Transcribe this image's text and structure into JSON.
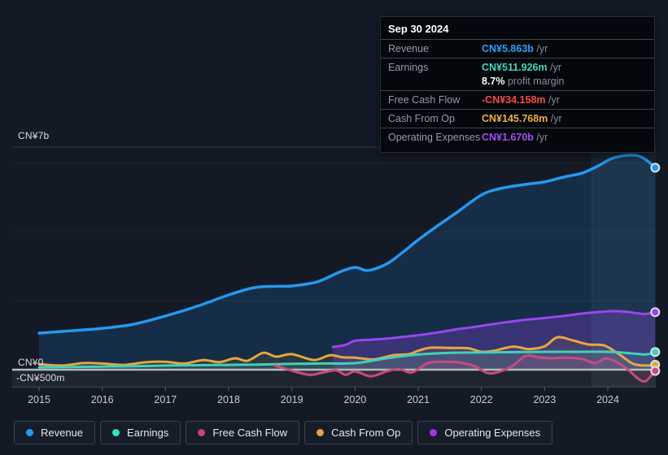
{
  "tooltip": {
    "date": "Sep 30 2024",
    "rows": [
      {
        "label": "Revenue",
        "value": "CN¥5.863b",
        "suffix": " /yr",
        "color": "#2d9ff6"
      },
      {
        "label": "Earnings",
        "value": "CN¥511.926m",
        "suffix": " /yr",
        "color": "#41d6bd",
        "sub_value": "8.7%",
        "sub_text": " profit margin"
      },
      {
        "label": "Free Cash Flow",
        "value": "-CN¥34.158m",
        "suffix": " /yr",
        "color": "#fb4b43"
      },
      {
        "label": "Cash From Op",
        "value": "CN¥145.768m",
        "suffix": " /yr",
        "color": "#ecaf3e"
      },
      {
        "label": "Operating Expenses",
        "value": "CN¥1.670b",
        "suffix": " /yr",
        "color": "#a34ff6"
      }
    ]
  },
  "legend": {
    "items": [
      {
        "label": "Revenue",
        "color": "#1e9df2"
      },
      {
        "label": "Earnings",
        "color": "#30e3c3"
      },
      {
        "label": "Free Cash Flow",
        "color": "#c6417d"
      },
      {
        "label": "Cash From Op",
        "color": "#e5a43c"
      },
      {
        "label": "Operating Expenses",
        "color": "#9e35ea"
      }
    ]
  },
  "chart_data": {
    "type": "line",
    "title": "Company financial history (revenue, earnings and cash flows), CN¥, 2015 - Sep 30 2024",
    "currency_unit": "CN¥ billions",
    "x_axis": {
      "ticks": [
        "2015",
        "2016",
        "2017",
        "2018",
        "2019",
        "2020",
        "2021",
        "2022",
        "2023",
        "2024"
      ],
      "range": [
        2014.57,
        2024.78
      ]
    },
    "y_axis": {
      "labels": [
        "CN¥7b",
        "CN¥0",
        "-CN¥500m"
      ],
      "range_b": [
        -0.5,
        6.46
      ],
      "gridlines_b": [
        2,
        4,
        6
      ],
      "zero_b": 0,
      "bottom_b": -0.5
    },
    "highlight_band_from_year": 2023.75,
    "series": [
      {
        "name": "Revenue",
        "color": "#2598f0",
        "fill": "rgba(33,150,243,0.16)",
        "width": 3.5,
        "points": [
          [
            2015,
            1.06
          ],
          [
            2015.5,
            1.13
          ],
          [
            2016,
            1.2
          ],
          [
            2016.5,
            1.32
          ],
          [
            2017,
            1.56
          ],
          [
            2017.5,
            1.84
          ],
          [
            2018,
            2.17
          ],
          [
            2018.4,
            2.38
          ],
          [
            2018.75,
            2.42
          ],
          [
            2019,
            2.43
          ],
          [
            2019.4,
            2.55
          ],
          [
            2019.75,
            2.83
          ],
          [
            2020,
            2.97
          ],
          [
            2020.2,
            2.88
          ],
          [
            2020.5,
            3.07
          ],
          [
            2020.75,
            3.4
          ],
          [
            2021,
            3.77
          ],
          [
            2021.3,
            4.17
          ],
          [
            2021.6,
            4.55
          ],
          [
            2022,
            5.07
          ],
          [
            2022.3,
            5.26
          ],
          [
            2022.7,
            5.38
          ],
          [
            2023,
            5.45
          ],
          [
            2023.3,
            5.59
          ],
          [
            2023.6,
            5.71
          ],
          [
            2023.85,
            5.92
          ],
          [
            2024.05,
            6.12
          ],
          [
            2024.25,
            6.21
          ],
          [
            2024.45,
            6.22
          ],
          [
            2024.6,
            6.1
          ],
          [
            2024.75,
            5.863
          ]
        ]
      },
      {
        "name": "Operating Expenses",
        "color": "#9a45ef",
        "fill": "rgba(148,70,240,0.27)",
        "width": 3,
        "points": [
          [
            2019.65,
            0.66
          ],
          [
            2019.85,
            0.72
          ],
          [
            2020,
            0.84
          ],
          [
            2020.25,
            0.87
          ],
          [
            2020.5,
            0.9
          ],
          [
            2020.75,
            0.95
          ],
          [
            2021,
            1.0
          ],
          [
            2021.3,
            1.08
          ],
          [
            2021.6,
            1.17
          ],
          [
            2021.85,
            1.23
          ],
          [
            2022.1,
            1.3
          ],
          [
            2022.4,
            1.38
          ],
          [
            2022.7,
            1.45
          ],
          [
            2023,
            1.5
          ],
          [
            2023.3,
            1.56
          ],
          [
            2023.6,
            1.63
          ],
          [
            2023.9,
            1.68
          ],
          [
            2024.1,
            1.7
          ],
          [
            2024.3,
            1.68
          ],
          [
            2024.5,
            1.63
          ],
          [
            2024.62,
            1.62
          ],
          [
            2024.75,
            1.67
          ]
        ]
      },
      {
        "name": "Cash From Op",
        "color": "#e8a63e",
        "fill": "rgba(233,168,62,0.10)",
        "width": 3,
        "points": [
          [
            2015,
            0.16
          ],
          [
            2015.35,
            0.12
          ],
          [
            2015.7,
            0.19
          ],
          [
            2016,
            0.18
          ],
          [
            2016.35,
            0.14
          ],
          [
            2016.7,
            0.22
          ],
          [
            2017,
            0.23
          ],
          [
            2017.3,
            0.18
          ],
          [
            2017.6,
            0.28
          ],
          [
            2017.85,
            0.22
          ],
          [
            2018.1,
            0.33
          ],
          [
            2018.3,
            0.26
          ],
          [
            2018.55,
            0.49
          ],
          [
            2018.75,
            0.38
          ],
          [
            2019,
            0.45
          ],
          [
            2019.35,
            0.28
          ],
          [
            2019.6,
            0.42
          ],
          [
            2019.8,
            0.36
          ],
          [
            2020,
            0.35
          ],
          [
            2020.3,
            0.3
          ],
          [
            2020.6,
            0.42
          ],
          [
            2020.85,
            0.45
          ],
          [
            2021,
            0.55
          ],
          [
            2021.2,
            0.64
          ],
          [
            2021.5,
            0.63
          ],
          [
            2021.8,
            0.62
          ],
          [
            2022,
            0.52
          ],
          [
            2022.2,
            0.55
          ],
          [
            2022.5,
            0.67
          ],
          [
            2022.75,
            0.6
          ],
          [
            2023,
            0.68
          ],
          [
            2023.2,
            0.94
          ],
          [
            2023.45,
            0.85
          ],
          [
            2023.7,
            0.73
          ],
          [
            2023.95,
            0.7
          ],
          [
            2024.2,
            0.42
          ],
          [
            2024.4,
            0.17
          ],
          [
            2024.6,
            0.12
          ],
          [
            2024.75,
            0.1458
          ]
        ]
      },
      {
        "name": "Earnings",
        "color": "#41d0ba",
        "fill": "rgba(69,213,189,0.13)",
        "width": 3,
        "points": [
          [
            2015,
            0.07
          ],
          [
            2015.5,
            0.08
          ],
          [
            2016,
            0.09
          ],
          [
            2016.5,
            0.1
          ],
          [
            2017,
            0.12
          ],
          [
            2017.5,
            0.13
          ],
          [
            2018,
            0.14
          ],
          [
            2018.5,
            0.15
          ],
          [
            2019,
            0.17
          ],
          [
            2019.5,
            0.18
          ],
          [
            2020,
            0.19
          ],
          [
            2020.5,
            0.33
          ],
          [
            2021,
            0.44
          ],
          [
            2021.5,
            0.49
          ],
          [
            2022,
            0.5
          ],
          [
            2022.5,
            0.51
          ],
          [
            2023,
            0.52
          ],
          [
            2023.5,
            0.52
          ],
          [
            2024,
            0.52
          ],
          [
            2024.4,
            0.47
          ],
          [
            2024.6,
            0.44
          ],
          [
            2024.75,
            0.512
          ]
        ]
      },
      {
        "name": "Free Cash Flow",
        "color": "#c84b82",
        "fill": "rgba(203,75,132,0.16)",
        "width": 3,
        "points": [
          [
            2018.73,
            0.12
          ],
          [
            2018.9,
            0.03
          ],
          [
            2019.1,
            -0.08
          ],
          [
            2019.3,
            -0.15
          ],
          [
            2019.5,
            -0.08
          ],
          [
            2019.7,
            -0.02
          ],
          [
            2019.85,
            -0.15
          ],
          [
            2020,
            -0.05
          ],
          [
            2020.25,
            -0.19
          ],
          [
            2020.5,
            -0.05
          ],
          [
            2020.7,
            0.02
          ],
          [
            2020.9,
            -0.08
          ],
          [
            2021.15,
            0.19
          ],
          [
            2021.4,
            0.23
          ],
          [
            2021.65,
            0.21
          ],
          [
            2021.9,
            0.1
          ],
          [
            2022.1,
            -0.1
          ],
          [
            2022.3,
            -0.05
          ],
          [
            2022.5,
            0.12
          ],
          [
            2022.7,
            0.4
          ],
          [
            2022.9,
            0.36
          ],
          [
            2023.1,
            0.33
          ],
          [
            2023.35,
            0.35
          ],
          [
            2023.6,
            0.31
          ],
          [
            2023.8,
            0.19
          ],
          [
            2023.97,
            0.33
          ],
          [
            2024.15,
            0.21
          ],
          [
            2024.32,
            0.0
          ],
          [
            2024.48,
            -0.26
          ],
          [
            2024.6,
            -0.33
          ],
          [
            2024.75,
            -0.0342
          ]
        ]
      }
    ]
  }
}
